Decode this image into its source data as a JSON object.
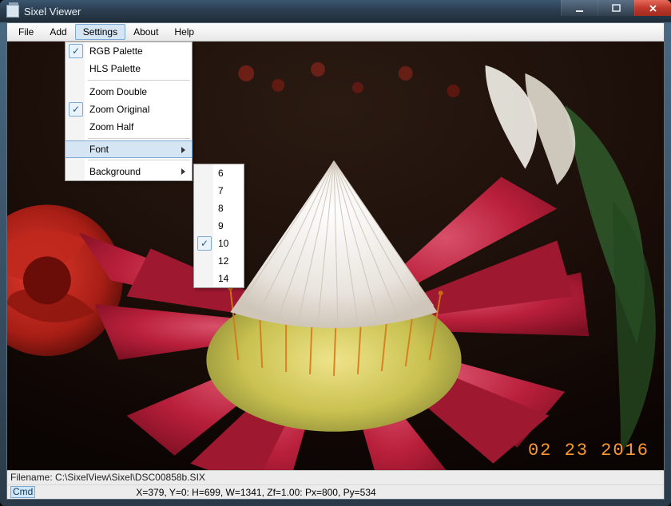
{
  "title": "Sixel Viewer",
  "menubar": [
    "File",
    "Add",
    "Settings",
    "About",
    "Help"
  ],
  "active_menu_index": 2,
  "settings_menu": {
    "groups": [
      [
        {
          "label": "RGB Palette",
          "checked": true
        },
        {
          "label": "HLS Palette",
          "checked": false
        }
      ],
      [
        {
          "label": "Zoom Double",
          "checked": false
        },
        {
          "label": "Zoom Original",
          "checked": true
        },
        {
          "label": "Zoom Half",
          "checked": false
        }
      ],
      [
        {
          "label": "Font",
          "submenu": true,
          "highlight": true
        },
        {
          "label": "Background",
          "submenu": true
        }
      ]
    ]
  },
  "font_submenu": {
    "options": [
      "6",
      "7",
      "8",
      "9",
      "10",
      "12",
      "14"
    ],
    "checked": "10"
  },
  "status": {
    "filename_label": "Filename:",
    "filename_path": "C:\\SixelView\\Sixel\\DSC00858b.SIX",
    "cmd_label": "Cmd",
    "coords": "X=379, Y=0: H=699, W=1341, Zf=1.00: Px=800, Py=534"
  },
  "photo_timestamp": "02 23 2016"
}
